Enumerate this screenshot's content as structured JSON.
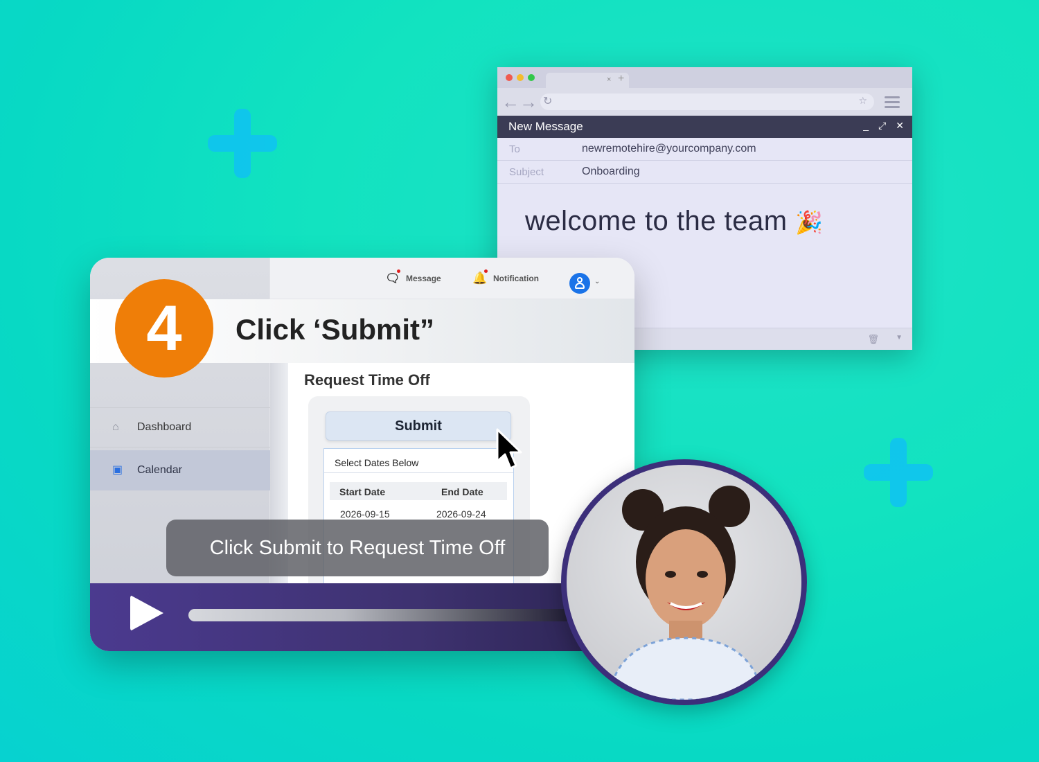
{
  "email_window": {
    "header_title": "New Message",
    "to_label": "To",
    "to_value": "newremotehire@yourcompany.com",
    "subject_label": "Subject",
    "subject_value": "Onboarding",
    "body_text": "welcome to the team",
    "body_emoji": "🎉"
  },
  "app": {
    "topbar": {
      "message_label": "Message",
      "notification_label": "Notification"
    },
    "step_number": "4",
    "step_title": "Click ‘Submit”",
    "sidebar": {
      "items": [
        {
          "label": "Dashboard",
          "icon": "home-icon"
        },
        {
          "label": "Calendar",
          "icon": "calendar-icon"
        }
      ]
    },
    "page_heading": "Request Time Off",
    "submit_label": "Submit",
    "dates": {
      "title": "Select Dates Below",
      "start_header": "Start Date",
      "end_header": "End Date",
      "start_value": "2026-09-15",
      "end_value": "2026-09-24"
    },
    "caption": "Click Submit to Request Time Off"
  },
  "colors": {
    "accent_orange": "#ef7e08",
    "player_purple": "#4b3a8f",
    "background_teal": "#12e3c0"
  }
}
